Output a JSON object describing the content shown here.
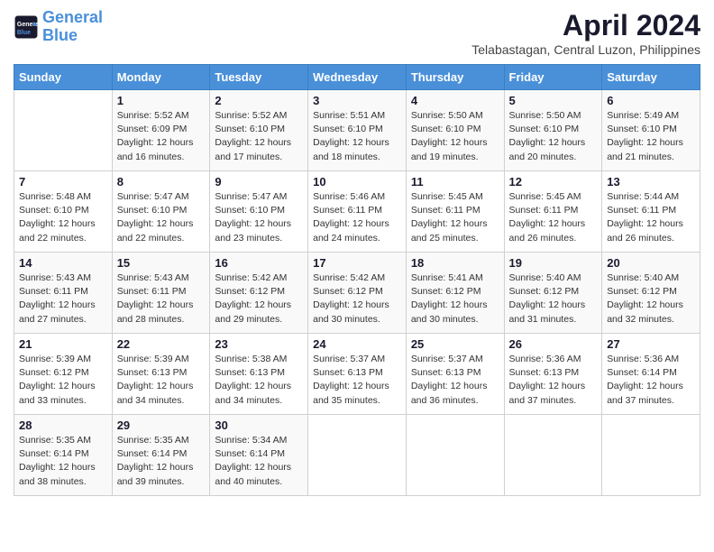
{
  "header": {
    "logo_line1": "General",
    "logo_line2": "Blue",
    "title": "April 2024",
    "subtitle": "Telabastagan, Central Luzon, Philippines"
  },
  "weekdays": [
    "Sunday",
    "Monday",
    "Tuesday",
    "Wednesday",
    "Thursday",
    "Friday",
    "Saturday"
  ],
  "weeks": [
    [
      {
        "num": "",
        "info": ""
      },
      {
        "num": "1",
        "info": "Sunrise: 5:52 AM\nSunset: 6:09 PM\nDaylight: 12 hours\nand 16 minutes."
      },
      {
        "num": "2",
        "info": "Sunrise: 5:52 AM\nSunset: 6:10 PM\nDaylight: 12 hours\nand 17 minutes."
      },
      {
        "num": "3",
        "info": "Sunrise: 5:51 AM\nSunset: 6:10 PM\nDaylight: 12 hours\nand 18 minutes."
      },
      {
        "num": "4",
        "info": "Sunrise: 5:50 AM\nSunset: 6:10 PM\nDaylight: 12 hours\nand 19 minutes."
      },
      {
        "num": "5",
        "info": "Sunrise: 5:50 AM\nSunset: 6:10 PM\nDaylight: 12 hours\nand 20 minutes."
      },
      {
        "num": "6",
        "info": "Sunrise: 5:49 AM\nSunset: 6:10 PM\nDaylight: 12 hours\nand 21 minutes."
      }
    ],
    [
      {
        "num": "7",
        "info": "Sunrise: 5:48 AM\nSunset: 6:10 PM\nDaylight: 12 hours\nand 22 minutes."
      },
      {
        "num": "8",
        "info": "Sunrise: 5:47 AM\nSunset: 6:10 PM\nDaylight: 12 hours\nand 22 minutes."
      },
      {
        "num": "9",
        "info": "Sunrise: 5:47 AM\nSunset: 6:10 PM\nDaylight: 12 hours\nand 23 minutes."
      },
      {
        "num": "10",
        "info": "Sunrise: 5:46 AM\nSunset: 6:11 PM\nDaylight: 12 hours\nand 24 minutes."
      },
      {
        "num": "11",
        "info": "Sunrise: 5:45 AM\nSunset: 6:11 PM\nDaylight: 12 hours\nand 25 minutes."
      },
      {
        "num": "12",
        "info": "Sunrise: 5:45 AM\nSunset: 6:11 PM\nDaylight: 12 hours\nand 26 minutes."
      },
      {
        "num": "13",
        "info": "Sunrise: 5:44 AM\nSunset: 6:11 PM\nDaylight: 12 hours\nand 26 minutes."
      }
    ],
    [
      {
        "num": "14",
        "info": "Sunrise: 5:43 AM\nSunset: 6:11 PM\nDaylight: 12 hours\nand 27 minutes."
      },
      {
        "num": "15",
        "info": "Sunrise: 5:43 AM\nSunset: 6:11 PM\nDaylight: 12 hours\nand 28 minutes."
      },
      {
        "num": "16",
        "info": "Sunrise: 5:42 AM\nSunset: 6:12 PM\nDaylight: 12 hours\nand 29 minutes."
      },
      {
        "num": "17",
        "info": "Sunrise: 5:42 AM\nSunset: 6:12 PM\nDaylight: 12 hours\nand 30 minutes."
      },
      {
        "num": "18",
        "info": "Sunrise: 5:41 AM\nSunset: 6:12 PM\nDaylight: 12 hours\nand 30 minutes."
      },
      {
        "num": "19",
        "info": "Sunrise: 5:40 AM\nSunset: 6:12 PM\nDaylight: 12 hours\nand 31 minutes."
      },
      {
        "num": "20",
        "info": "Sunrise: 5:40 AM\nSunset: 6:12 PM\nDaylight: 12 hours\nand 32 minutes."
      }
    ],
    [
      {
        "num": "21",
        "info": "Sunrise: 5:39 AM\nSunset: 6:12 PM\nDaylight: 12 hours\nand 33 minutes."
      },
      {
        "num": "22",
        "info": "Sunrise: 5:39 AM\nSunset: 6:13 PM\nDaylight: 12 hours\nand 34 minutes."
      },
      {
        "num": "23",
        "info": "Sunrise: 5:38 AM\nSunset: 6:13 PM\nDaylight: 12 hours\nand 34 minutes."
      },
      {
        "num": "24",
        "info": "Sunrise: 5:37 AM\nSunset: 6:13 PM\nDaylight: 12 hours\nand 35 minutes."
      },
      {
        "num": "25",
        "info": "Sunrise: 5:37 AM\nSunset: 6:13 PM\nDaylight: 12 hours\nand 36 minutes."
      },
      {
        "num": "26",
        "info": "Sunrise: 5:36 AM\nSunset: 6:13 PM\nDaylight: 12 hours\nand 37 minutes."
      },
      {
        "num": "27",
        "info": "Sunrise: 5:36 AM\nSunset: 6:14 PM\nDaylight: 12 hours\nand 37 minutes."
      }
    ],
    [
      {
        "num": "28",
        "info": "Sunrise: 5:35 AM\nSunset: 6:14 PM\nDaylight: 12 hours\nand 38 minutes."
      },
      {
        "num": "29",
        "info": "Sunrise: 5:35 AM\nSunset: 6:14 PM\nDaylight: 12 hours\nand 39 minutes."
      },
      {
        "num": "30",
        "info": "Sunrise: 5:34 AM\nSunset: 6:14 PM\nDaylight: 12 hours\nand 40 minutes."
      },
      {
        "num": "",
        "info": ""
      },
      {
        "num": "",
        "info": ""
      },
      {
        "num": "",
        "info": ""
      },
      {
        "num": "",
        "info": ""
      }
    ]
  ]
}
